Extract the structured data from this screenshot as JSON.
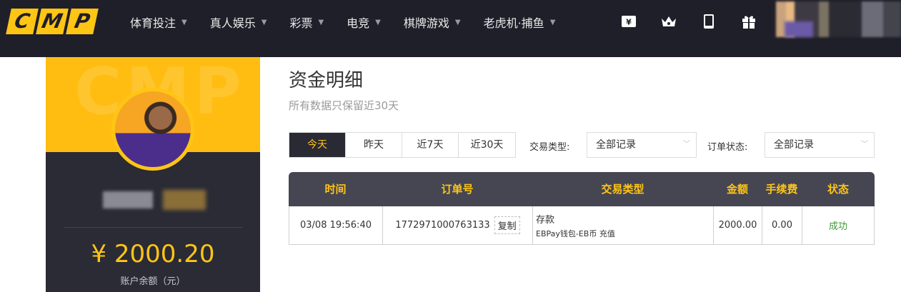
{
  "logo": {
    "letters": [
      "C",
      "M",
      "P"
    ]
  },
  "nav": {
    "items": [
      {
        "label": "体育投注"
      },
      {
        "label": "真人娱乐"
      },
      {
        "label": "彩票"
      },
      {
        "label": "电竞"
      },
      {
        "label": "棋牌游戏"
      },
      {
        "label": "老虎机·捕鱼"
      }
    ],
    "icons": [
      "ticket-icon",
      "crown-icon",
      "mobile-icon",
      "gift-icon"
    ]
  },
  "profile": {
    "balance": "¥ 2000.20",
    "balance_label": "账户余额（元）"
  },
  "page": {
    "title": "资金明细",
    "subtitle": "所有数据只保留近30天"
  },
  "filters": {
    "ranges": [
      "今天",
      "昨天",
      "近7天",
      "近30天"
    ],
    "active_range": "今天",
    "type_label": "交易类型:",
    "type_value": "全部记录",
    "status_label": "订单状态:",
    "status_value": "全部记录"
  },
  "table": {
    "headers": [
      "时间",
      "订单号",
      "交易类型",
      "金额",
      "手续费",
      "状态"
    ],
    "rows": [
      {
        "time": "03/08 19:56:40",
        "order_no": "1772971000763133",
        "copy_label": "复制",
        "type_main": "存款",
        "type_sub": "EBPay钱包-EB币 充值",
        "amount": "2000.00",
        "fee": "0.00",
        "status": "成功"
      }
    ]
  },
  "colors": {
    "accent": "#ffc515",
    "nav_bg": "#1f1f29",
    "panel_bg": "#2b2b35",
    "table_header_bg": "#464652",
    "success": "#3b9a34"
  }
}
